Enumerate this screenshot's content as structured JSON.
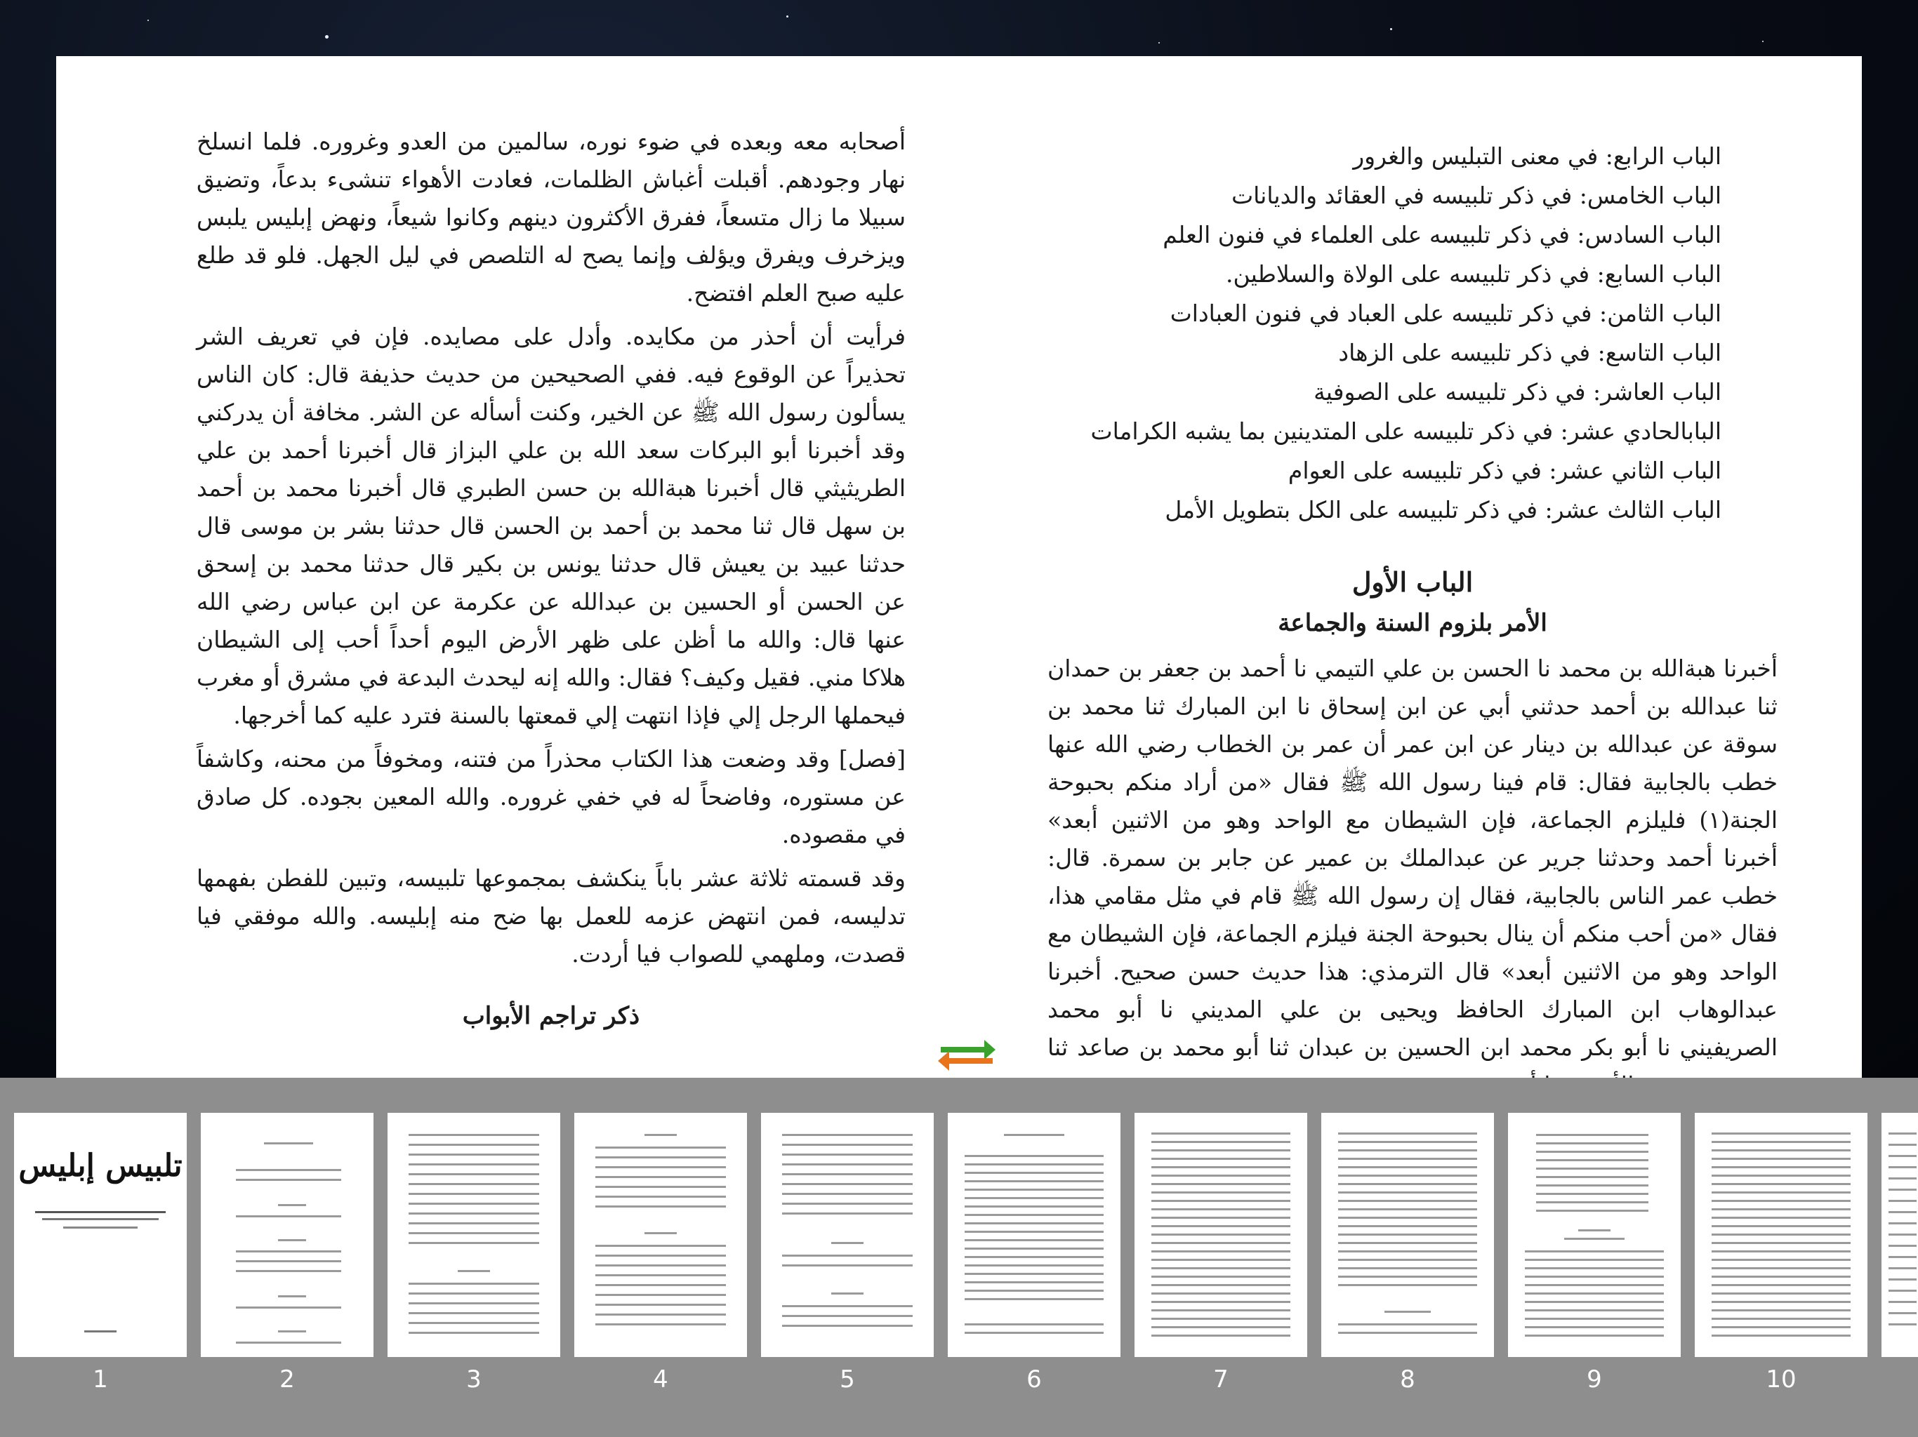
{
  "right_page": {
    "toc": [
      "الباب الرابع: في معنى التبليس والغرور",
      "الباب الخامس: في ذكر تلبيسه في العقائد والديانات",
      "الباب السادس: في ذكر تلبيسه على العلماء في فنون العلم",
      "الباب السابع: في ذكر تلبيسه على الولاة والسلاطين.",
      "الباب الثامن: في ذكر تلبيسه على العباد في فنون العبادات",
      "الباب التاسع: في ذكر تلبيسه على الزهاد",
      "الباب العاشر: في ذكر تلبيسه على الصوفية",
      "البابالحادي عشر: في ذكر تلبيسه على المتدينين بما يشبه الكرامات",
      "الباب الثاني عشر: في ذكر تلبيسه على العوام",
      "الباب الثالث عشر: في ذكر تلبيسه على الكل بتطويل الأمل"
    ],
    "chapter_title": "الباب الأول",
    "chapter_subtitle": "الأمر بلزوم السنة والجماعة",
    "body": "أخبرنا هبةالله بن محمد نا الحسن بن علي التيمي نا أحمد بن جعفر بن حمدان ثنا عبدالله بن أحمد حدثني أبي عن ابن إسحاق نا ابن المبارك ثنا محمد بن سوقة عن عبدالله بن دينار عن ابن عمر أن عمر بن الخطاب رضي الله عنها خطب بالجابية فقال: قام فينا رسول الله ﷺ فقال «من أراد منكم بحبوحة الجنة(١) فليلزم الجماعة، فإن الشيطان مع الواحد وهو من الاثنين أبعد» أخبرنا أحمد وحدثنا جرير عن عبدالملك بن عمير عن جابر بن سمرة. قال: خطب عمر الناس بالجابية، فقال إن رسول الله ﷺ قام في مثل مقامي هذا، فقال «من أحب منكم أن ينال بحبوحة الجنة فيلزم الجماعة، فإن الشيطان مع الواحد وهو من الاثنين أبعد» قال الترمذي: هذا حديث حسن صحيح. أخبرنا عبدالوهاب ابن المبارك الحافظ ويحيى بن علي المديني نا أبو محمد الصريفيني نا أبو بكر محمد ابن الحسين بن عبدان ثنا أبو محمد بن صاعد ثنا سعيد بن يحيى الأموي ثنا أبو"
  },
  "left_page": {
    "paragraphs": [
      "أصحابه معه وبعده في ضوء نوره، سالمين من العدو وغروره. فلما انسلخ نهار وجودهم. أقبلت أغباش الظلمات، فعادت الأهواء تنشىء بدعاً، وتضيق سبيلا ما زال متسعاً، ففرق الأكثرون دينهم وكانوا شيعاً، ونهض إبليس يلبس ويزخرف ويفرق ويؤلف وإنما يصح له التلصص في ليل الجهل. فلو قد طلع عليه صبح العلم افتضح.",
      "فرأيت أن أحذر من مكايده. وأدل على مصايده. فإن في تعريف الشر تحذيراً عن الوقوع فيه. ففي الصحيحين من حديث حذيفة قال: كان الناس يسألون رسول الله ﷺ عن الخير، وكنت أسأله عن الشر. مخافة أن يدركني وقد أخبرنا أبو البركات سعد الله بن علي البزاز قال أخبرنا أحمد بن علي الطريثيثي قال أخبرنا هبةالله بن حسن الطبري قال أخبرنا محمد بن أحمد بن سهل قال ثنا محمد بن أحمد بن الحسن قال حدثنا بشر بن موسى قال حدثنا عبيد بن يعيش قال حدثنا يونس بن بكير قال حدثنا محمد بن إسحق عن الحسن أو الحسين بن عبدالله عن عكرمة عن ابن عباس رضي الله عنها قال: والله ما أظن على ظهر الأرض اليوم أحداً أحب إلى الشيطان هلاكا مني. فقيل وكيف؟ فقال: والله إنه ليحدث البدعة في مشرق أو مغرب فيحملها الرجل إلي فإذا انتهت إلي قمعتها بالسنة فترد عليه كما أخرجها.",
      "[فصل] وقد وضعت هذا الكتاب محذراً من فتنه، ومخوفاً من محنه، وكاشفاً عن مستوره، وفاضحاً له في خفي غروره. والله المعين بجوده. كل صادق في مقصوده.",
      "وقد قسمته ثلاثة عشر باباً ينكشف بمجموعها تلبيسه، وتبين للفطن بفهمها تدليسه، فمن انتهض عزمه للعمل بها ضح منه إبليسه. والله موفقي فيا قصدت، وملهمي للصواب فيا أردت."
    ],
    "section_heading": "ذكر تراجم الأبواب"
  },
  "thumbnails": [
    {
      "number": "1",
      "title": "تلبيس إبليس"
    },
    {
      "number": "2"
    },
    {
      "number": "3"
    },
    {
      "number": "4"
    },
    {
      "number": "5"
    },
    {
      "number": "6"
    },
    {
      "number": "7"
    },
    {
      "number": "8"
    },
    {
      "number": "9"
    },
    {
      "number": "10"
    }
  ],
  "icons": {
    "swap": "swap-arrows-icon"
  },
  "colors": {
    "tray": "#8e8e8e",
    "page": "#ffffff",
    "swap_green": "#3aa12c",
    "swap_orange": "#e8731a"
  }
}
